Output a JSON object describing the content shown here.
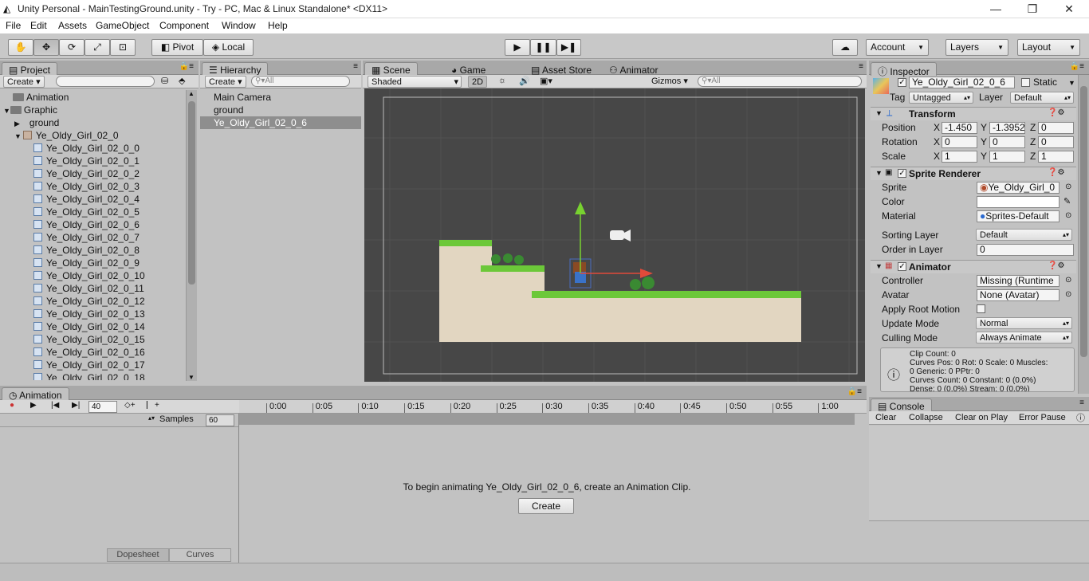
{
  "title": "Unity Personal - MainTestingGround.unity - Try - PC, Mac & Linux Standalone* <DX11>",
  "menu": [
    "File",
    "Edit",
    "Assets",
    "GameObject",
    "Component",
    "Window",
    "Help"
  ],
  "toolbar": {
    "pivot": "Pivot",
    "local": "Local",
    "account": "Account",
    "layers": "Layers",
    "layout": "Layout"
  },
  "project": {
    "tab": "Project",
    "create": "Create",
    "items": [
      "Animation",
      "Graphic",
      "ground",
      "Ye_Oldy_Girl_02_0"
    ],
    "sprites": [
      "Ye_Oldy_Girl_02_0_0",
      "Ye_Oldy_Girl_02_0_1",
      "Ye_Oldy_Girl_02_0_2",
      "Ye_Oldy_Girl_02_0_3",
      "Ye_Oldy_Girl_02_0_4",
      "Ye_Oldy_Girl_02_0_5",
      "Ye_Oldy_Girl_02_0_6",
      "Ye_Oldy_Girl_02_0_7",
      "Ye_Oldy_Girl_02_0_8",
      "Ye_Oldy_Girl_02_0_9",
      "Ye_Oldy_Girl_02_0_10",
      "Ye_Oldy_Girl_02_0_11",
      "Ye_Oldy_Girl_02_0_12",
      "Ye_Oldy_Girl_02_0_13",
      "Ye_Oldy_Girl_02_0_14",
      "Ye_Oldy_Girl_02_0_15",
      "Ye_Oldy_Girl_02_0_16",
      "Ye_Oldy_Girl_02_0_17",
      "Ye_Oldy_Girl_02_0_18"
    ]
  },
  "hierarchy": {
    "tab": "Hierarchy",
    "create": "Create",
    "search": "All",
    "items": [
      "Main Camera",
      "ground",
      "Ye_Oldy_Girl_02_0_6"
    ]
  },
  "scene": {
    "tabs": [
      "Scene",
      "Game",
      "Asset Store",
      "Animator"
    ],
    "shaded": "Shaded",
    "mode2d": "2D",
    "gizmos": "Gizmos",
    "search": "All"
  },
  "inspector": {
    "tab": "Inspector",
    "name": "Ye_Oldy_Girl_02_0_6",
    "static": "Static",
    "tag_label": "Tag",
    "tag": "Untagged",
    "layer_label": "Layer",
    "layer": "Default",
    "transform": {
      "title": "Transform",
      "position": "Position",
      "rotation": "Rotation",
      "scale": "Scale",
      "px": "-1.450",
      "py": "-1.3952",
      "pz": "0",
      "rx": "0",
      "ry": "0",
      "rz": "0",
      "sx": "1",
      "sy": "1",
      "sz": "1"
    },
    "sprite_renderer": {
      "title": "Sprite Renderer",
      "sprite_label": "Sprite",
      "sprite": "Ye_Oldy_Girl_0",
      "color_label": "Color",
      "material_label": "Material",
      "material": "Sprites-Default",
      "sorting_label": "Sorting Layer",
      "sorting": "Default",
      "order_label": "Order in Layer",
      "order": "0"
    },
    "animator": {
      "title": "Animator",
      "controller_label": "Controller",
      "controller": "Missing (Runtime",
      "avatar_label": "Avatar",
      "avatar": "None (Avatar)",
      "root_label": "Apply Root Motion",
      "update_label": "Update Mode",
      "update": "Normal",
      "culling_label": "Culling Mode",
      "culling": "Always Animate",
      "info": [
        "Clip Count: 0",
        "Curves Pos: 0 Rot: 0 Scale: 0 Muscles:",
        "0 Generic: 0 PPtr: 0",
        "Curves Count: 0 Constant: 0 (0.0%)",
        "Dense: 0 (0.0%) Stream: 0 (0.0%)"
      ]
    }
  },
  "animation": {
    "tab": "Animation",
    "frame": "40",
    "samples_label": "Samples",
    "samples": "60",
    "message": "To begin animating Ye_Oldy_Girl_02_0_6, create an Animation Clip.",
    "create": "Create",
    "dopesheet": "Dopesheet",
    "curves": "Curves",
    "ticks": [
      "0:00",
      "0:05",
      "0:10",
      "0:15",
      "0:20",
      "0:25",
      "0:30",
      "0:35",
      "0:40",
      "0:45",
      "0:50",
      "0:55",
      "1:00"
    ]
  },
  "console": {
    "tab": "Console",
    "buttons": [
      "Clear",
      "Collapse",
      "Clear on Play",
      "Error Pause"
    ]
  }
}
